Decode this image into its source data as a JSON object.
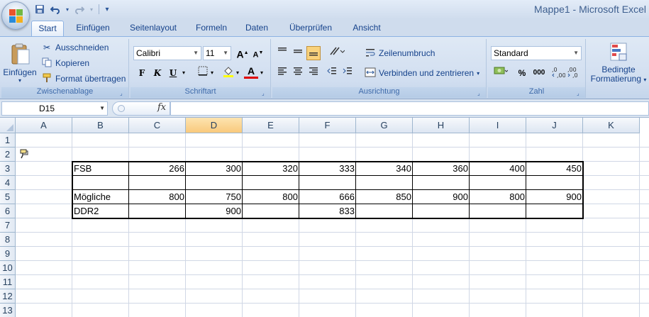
{
  "window": {
    "title": "Mappe1 - Microsoft Excel"
  },
  "quick_access": {
    "save_icon": "save-icon",
    "undo_icon": "undo-icon",
    "redo_icon": "redo-icon",
    "customize_icon": "customize-icon"
  },
  "tabs": [
    {
      "label": "Start",
      "active": true
    },
    {
      "label": "Einfügen"
    },
    {
      "label": "Seitenlayout"
    },
    {
      "label": "Formeln"
    },
    {
      "label": "Daten"
    },
    {
      "label": "Überprüfen"
    },
    {
      "label": "Ansicht"
    }
  ],
  "ribbon": {
    "clipboard": {
      "label": "Zwischenablage",
      "paste": "Einfügen",
      "cut": "Ausschneiden",
      "copy": "Kopieren",
      "format_painter": "Format übertragen"
    },
    "font": {
      "label": "Schriftart",
      "font_name": "Calibri",
      "font_size": "11",
      "bold": "F",
      "italic": "K",
      "underline": "U",
      "grow": "A",
      "shrink": "A",
      "font_color": "A"
    },
    "alignment": {
      "label": "Ausrichtung",
      "wrap": "Zeilenumbruch",
      "merge": "Verbinden und zentrieren"
    },
    "number": {
      "label": "Zahl",
      "format": "Standard",
      "percent": "%",
      "thousands": "000",
      "inc_decimal": ",0 ,00",
      "dec_decimal": ",00 ,0"
    },
    "styles": {
      "conditional": "Bedingte",
      "conditional2": "Formatierung"
    }
  },
  "formula_bar": {
    "name_box": "D15",
    "fx": "fx",
    "content": ""
  },
  "columns": [
    "A",
    "B",
    "C",
    "D",
    "E",
    "F",
    "G",
    "H",
    "I",
    "J",
    "K"
  ],
  "rows": [
    "1",
    "2",
    "3",
    "4",
    "5",
    "6",
    "7",
    "8",
    "9",
    "10",
    "11",
    "12",
    "13"
  ],
  "cells": {
    "B3": "FSB",
    "C3": "266",
    "D3": "300",
    "E3": "320",
    "F3": "333",
    "G3": "340",
    "H3": "360",
    "I3": "400",
    "J3": "450",
    "B5": "Mögliche",
    "C5": "800",
    "D5": "750",
    "E5": "800",
    "F5": "666",
    "G5": "850",
    "H5": "900",
    "I5": "800",
    "J5": "900",
    "B6": "DDR2",
    "D6": "900",
    "F6": "833"
  },
  "selected_column": "D"
}
